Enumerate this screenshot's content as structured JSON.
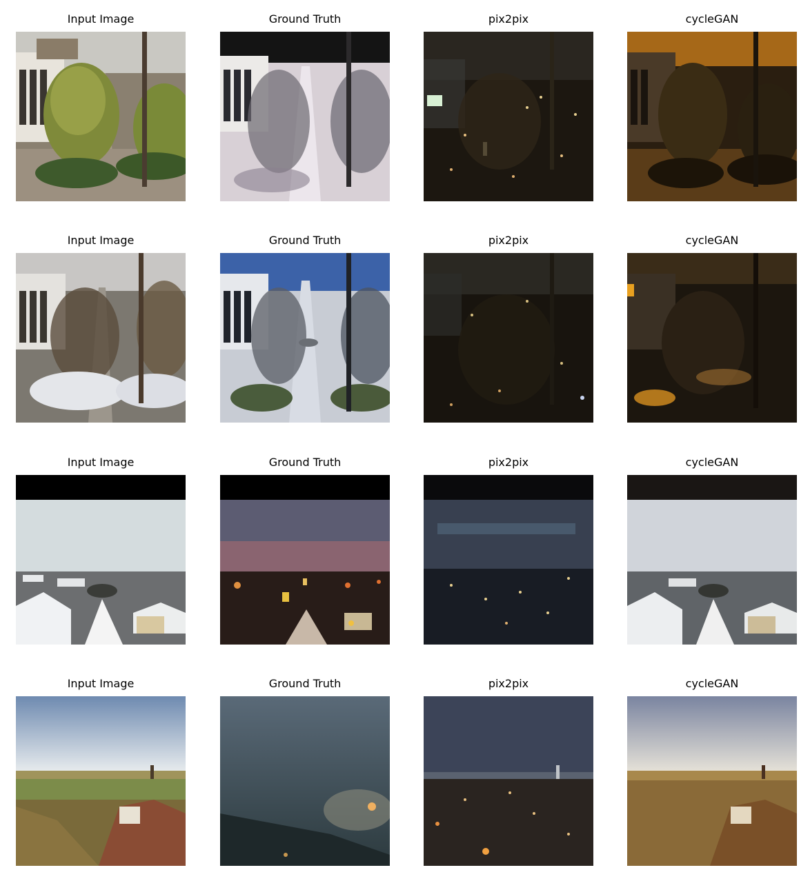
{
  "figure": {
    "rows": [
      {
        "cells": [
          {
            "title": "Input Image"
          },
          {
            "title": "Ground Truth"
          },
          {
            "title": "pix2pix"
          },
          {
            "title": "cycleGAN"
          }
        ]
      },
      {
        "cells": [
          {
            "title": "Input Image"
          },
          {
            "title": "Ground Truth"
          },
          {
            "title": "pix2pix"
          },
          {
            "title": "cycleGAN"
          }
        ]
      },
      {
        "cells": [
          {
            "title": "Input Image"
          },
          {
            "title": "Ground Truth"
          },
          {
            "title": "pix2pix"
          },
          {
            "title": "cycleGAN"
          }
        ]
      },
      {
        "cells": [
          {
            "title": "Input Image"
          },
          {
            "title": "Ground Truth"
          },
          {
            "title": "pix2pix"
          },
          {
            "title": "cycleGAN"
          }
        ]
      }
    ]
  }
}
